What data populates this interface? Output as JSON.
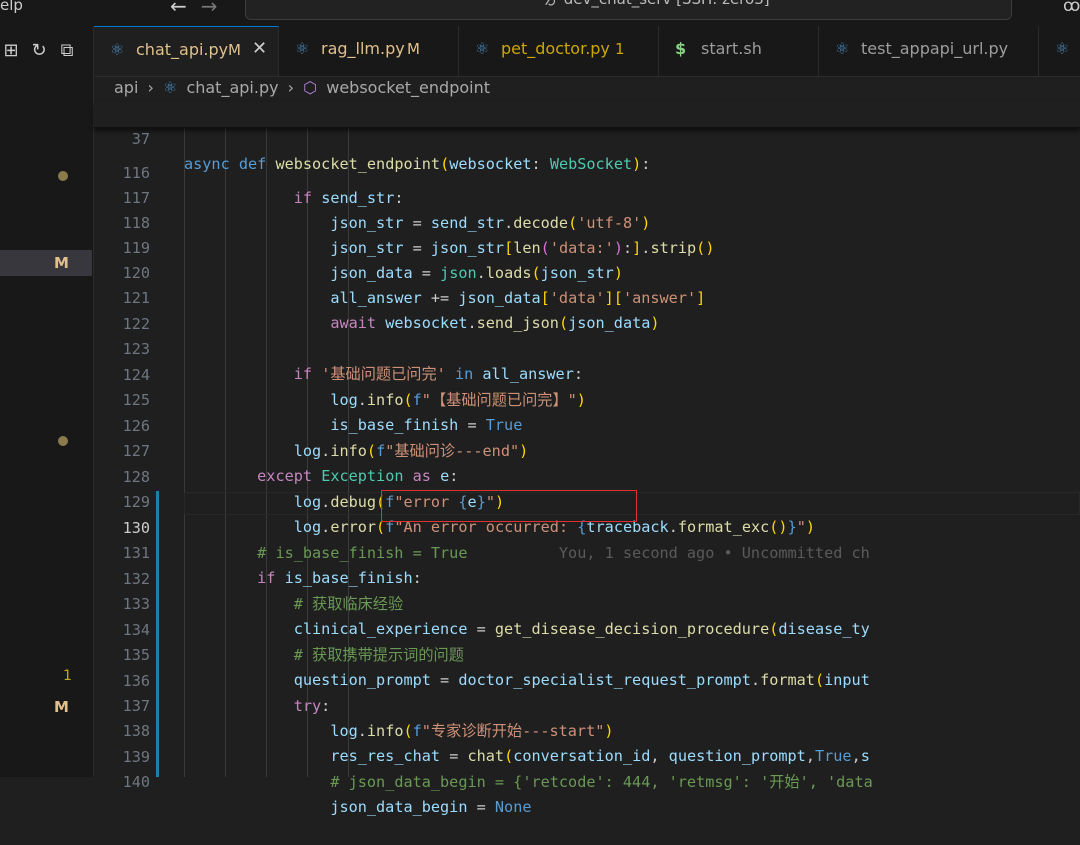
{
  "titlebar": {
    "menu_partial": "elp",
    "back": "←",
    "forward": "→",
    "command_center": "ゟ dev_chat_serv [SSH: zero3]",
    "copilot": "ꝏ"
  },
  "left_panel": {
    "icons": [
      "⊞",
      "↻",
      "⧉"
    ],
    "active_badge": "M",
    "badge_one": "1",
    "badge_m": "M"
  },
  "tabs": [
    {
      "name": "chat_api.py",
      "badge": "M",
      "close": "✕",
      "active": true
    },
    {
      "name": "rag_llm.py",
      "badge": "M"
    },
    {
      "name": "pet_doctor.py",
      "badge": "1"
    },
    {
      "name": "start.sh",
      "badge": ""
    },
    {
      "name": "test_appapi_url.py",
      "badge": ""
    }
  ],
  "breadcrumb": {
    "root": "api",
    "sep": "›",
    "file": "chat_api.py",
    "symbol": "websocket_endpoint"
  },
  "editor": {
    "line_numbers": [
      "37",
      "116",
      "117",
      "118",
      "119",
      "120",
      "121",
      "122",
      "123",
      "124",
      "125",
      "126",
      "127",
      "128",
      "129",
      "130",
      "131",
      "132",
      "133",
      "134",
      "135",
      "136",
      "137",
      "138",
      "139",
      "140"
    ],
    "current_line": "130",
    "blame": "You, 1 second ago • Uncommitted ch",
    "text": {
      "str_utf8": "'utf-8'",
      "str_data_colon": "'data:'",
      "str_data": "'data'",
      "str_answer": "'answer'",
      "str_basic_done": "'基础问题已问完'",
      "str_basic_done_log": "\"【基础问题已问完】\"",
      "str_basic_end": "\"基础问诊---end\"",
      "str_error": "\"error ",
      "str_error_close": "\"",
      "str_error_occurred": "\"An error occurred: ",
      "comment_130": "# is_base_finish = True",
      "comment_132": "# 获取临床经验",
      "comment_134": "# 获取携带提示词的问题",
      "str_expert_start": "\"专家诊断开始---start\"",
      "comment_139": "# json_data_begin = {'retcode': 444, 'retmsg': '开始', 'data"
    }
  }
}
